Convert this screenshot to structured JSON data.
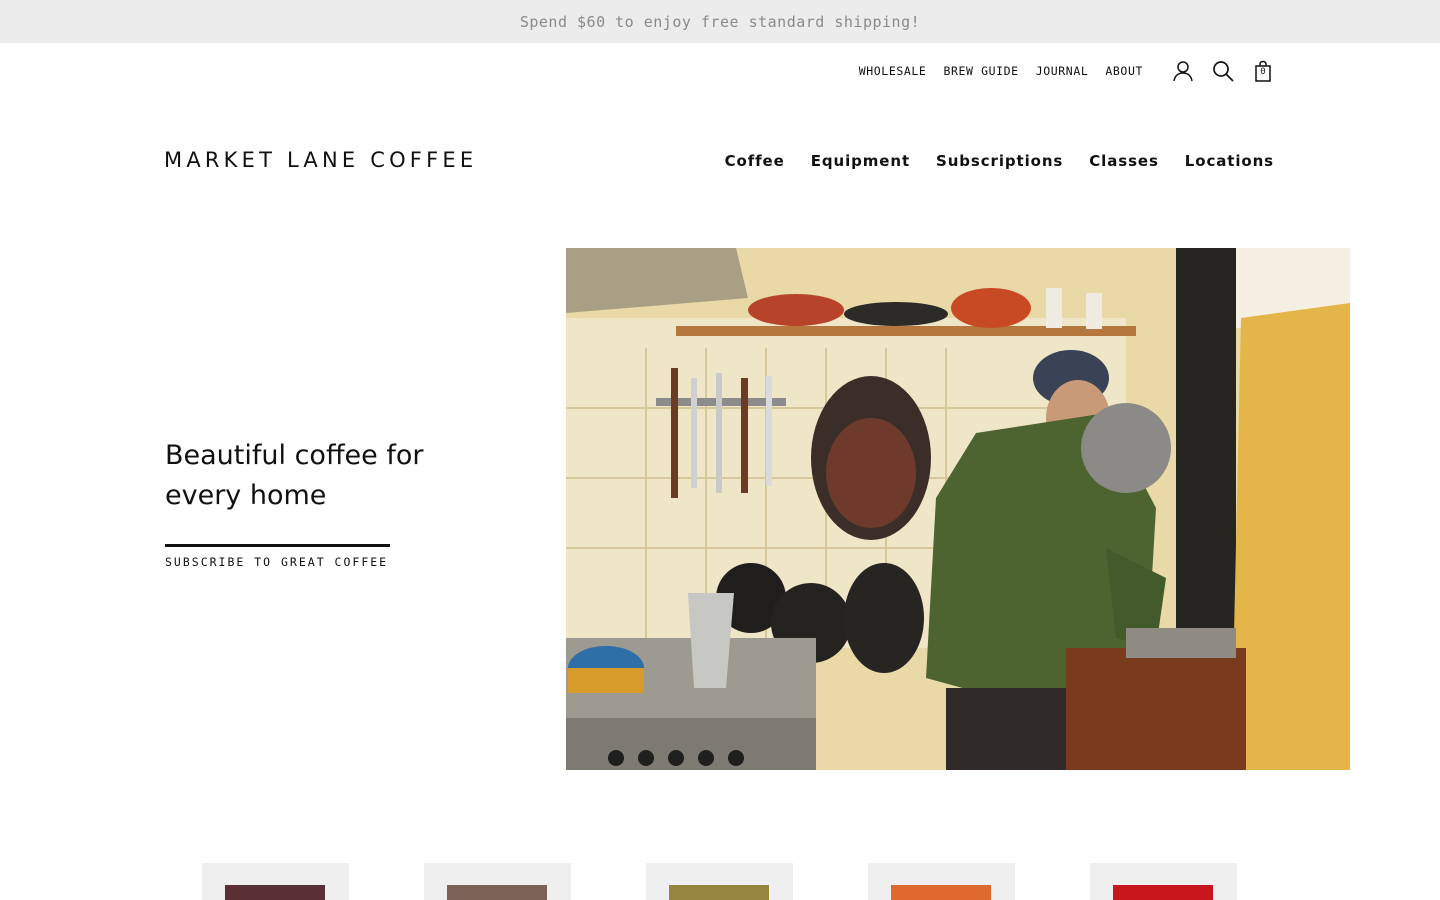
{
  "announcement": "Spend $60 to enjoy free standard shipping!",
  "utility_nav": {
    "links": [
      "WHOLESALE",
      "BREW GUIDE",
      "JOURNAL",
      "ABOUT"
    ],
    "account_icon": "user-icon",
    "search_icon": "search-icon",
    "cart_icon": "shopping-bag-icon",
    "cart_count": "0"
  },
  "logo": "MARKET LANE COFFEE",
  "main_nav": [
    "Coffee",
    "Equipment",
    "Subscriptions",
    "Classes",
    "Locations"
  ],
  "hero": {
    "title": "Beautiful coffee for every home",
    "cta": "SUBSCRIBE TO GREAT COFFEE",
    "image_description": "kitchen-scene"
  },
  "products": [
    {
      "bag_color": "#5a2f35"
    },
    {
      "bag_color": "#7c6256"
    },
    {
      "bag_color": "#958640"
    },
    {
      "bag_color": "#e0692e"
    },
    {
      "bag_color": "#c8161d"
    }
  ],
  "colors": {
    "announcement_bg": "#ececec",
    "announcement_text": "#8a8a8a",
    "text": "#111111"
  }
}
